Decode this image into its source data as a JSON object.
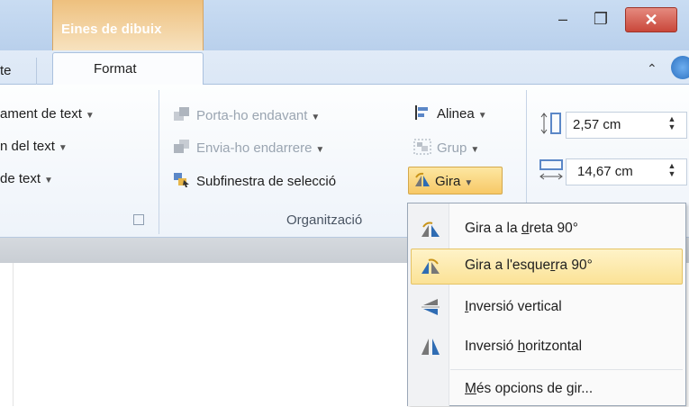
{
  "titlebar": {
    "context_tab": "Eines de dibuix",
    "minimize": "–",
    "maximize": "❐",
    "close": "✕"
  },
  "tabs": {
    "prev_partial": "te",
    "active": "Format",
    "collapse": "⌃"
  },
  "ribbon": {
    "text_group": [
      "ament de text",
      "n del text",
      "de text"
    ],
    "arrange": {
      "bring_forward": "Porta-ho endavant",
      "send_backward": "Envia-ho endarrere",
      "selection_pane": "Subfinestra de selecció",
      "align": "Alinea",
      "group": "Grup",
      "rotate": "Gira",
      "group_label": "Organització"
    },
    "size": {
      "height": "2,57 cm",
      "width": "14,67 cm"
    }
  },
  "rotate_menu": {
    "items": [
      {
        "pre": "Gira a la ",
        "key": "d",
        "post": "reta 90°"
      },
      {
        "pre": "Gira a l'esque",
        "key": "r",
        "post": "ra 90°"
      },
      {
        "pre": "",
        "key": "I",
        "post": "nversió vertical"
      },
      {
        "pre": "Inversió ",
        "key": "h",
        "post": "oritzontal"
      },
      {
        "pre": "",
        "key": "M",
        "post": "és opcions de gir..."
      }
    ]
  },
  "colors": {
    "accent_highlight": "#f7c866",
    "context_tab": "#eec07e",
    "close_button": "#c9473a"
  }
}
